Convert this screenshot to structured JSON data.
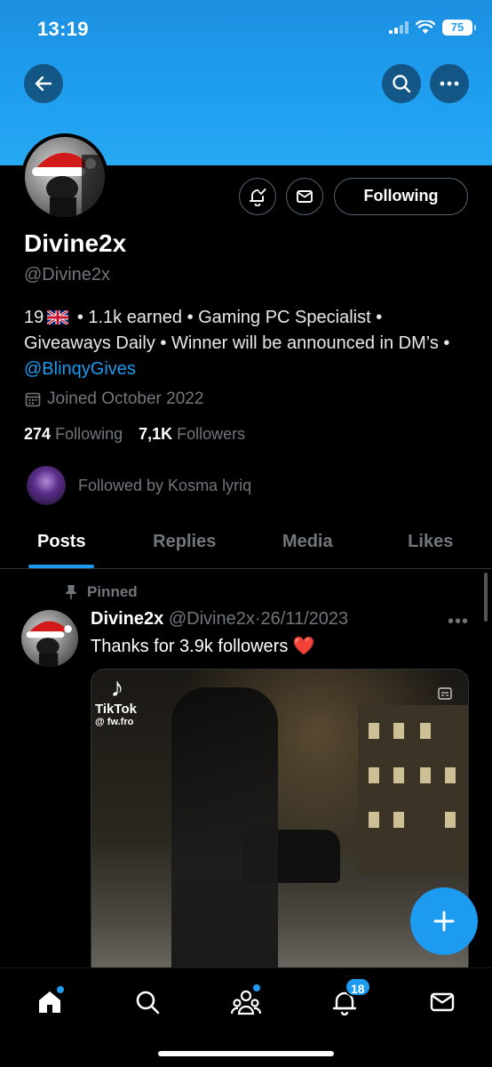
{
  "status_bar": {
    "time": "13:19",
    "battery": "75"
  },
  "profile": {
    "display_name": "Divine2x",
    "handle": "@Divine2x",
    "bio_before_flag": "19",
    "bio_after_flag": "• 1.1k earned • Gaming PC Specialist • Giveaways Daily • Winner will be announced in DM’s •",
    "bio_link": "@BlinqyGives",
    "joined": "Joined October 2022",
    "following_count": "274",
    "following_label": "Following",
    "followers_count": "7,1K",
    "followers_label": "Followers",
    "followed_by": "Followed by Kosma lyriq",
    "follow_button": "Following"
  },
  "tabs": [
    {
      "label": "Posts",
      "active": true
    },
    {
      "label": "Replies",
      "active": false
    },
    {
      "label": "Media",
      "active": false
    },
    {
      "label": "Likes",
      "active": false
    }
  ],
  "post": {
    "pinned_label": "Pinned",
    "author_name": "Divine2x",
    "author_handle": "@Divine2x",
    "separator": "·",
    "date": "26/11/2023",
    "text": "Thanks for 3.9k followers",
    "emoji": "❤️",
    "media_watermark_name": "TikTok",
    "media_watermark_handle": "@ fw.fro"
  },
  "bottom_nav": {
    "notifications_badge": "18"
  },
  "colors": {
    "accent": "#1d9bf0",
    "banner": "#1f9ef0",
    "background": "#000000",
    "muted": "#71767b"
  }
}
